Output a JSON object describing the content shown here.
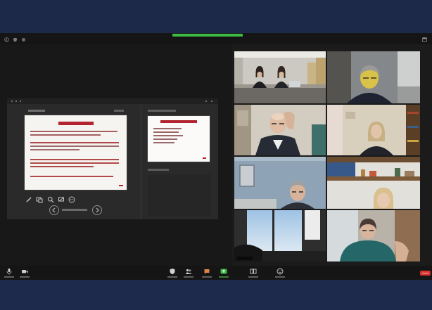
{
  "colors": {
    "frame_background": "#1c2949",
    "window_background": "#1b1b1b",
    "share_banner": "#3dbb45",
    "share_screen_button": "#3dbb45",
    "end_button": "#d9322e",
    "slide_title": "#b2242f"
  },
  "top_bar": {
    "icons": [
      "meeting-info-icon",
      "security-shield-icon",
      "recording-icon"
    ],
    "right_icon": "view-options-icon"
  },
  "presenter_view": {
    "tools": [
      "pen-icon",
      "see-all-slides-icon",
      "zoom-icon",
      "black-screen-icon",
      "more-options-icon"
    ],
    "navigation": [
      "previous-slide-icon",
      "next-slide-icon"
    ]
  },
  "toolbar": {
    "left": [
      "microphone-icon",
      "video-camera-icon"
    ],
    "center": [
      "security-icon",
      "participants-icon",
      "chat-icon",
      "share-screen-icon",
      "record-icon",
      "reactions-icon"
    ],
    "end": "end-meeting-icon"
  }
}
